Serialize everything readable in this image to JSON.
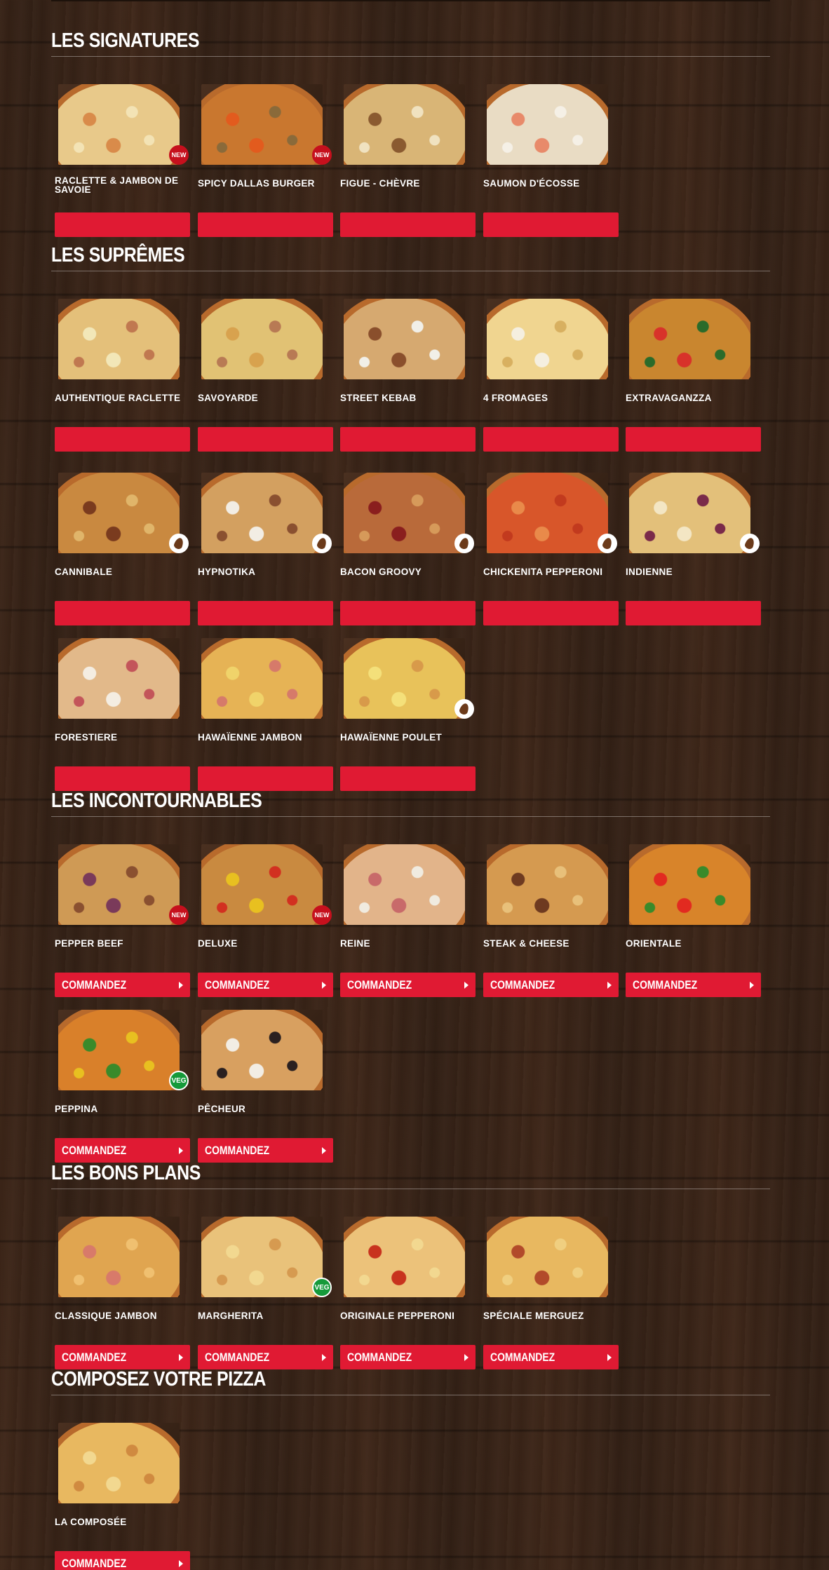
{
  "sections": [
    {
      "title": "LES SIGNATURES",
      "items": [
        {
          "name": "RACLETTE & JAMBON DE SAVOIE",
          "badge": "NEW",
          "colors": [
            "#e8c98a",
            "#d98b4a",
            "#f3e3b5"
          ]
        },
        {
          "name": "SPICY DALLAS BURGER",
          "badge": "NEW",
          "colors": [
            "#c9772f",
            "#e25b1e",
            "#8a6a3a"
          ]
        },
        {
          "name": "FIGUE - CHÈVRE",
          "badge": "",
          "colors": [
            "#d9b576",
            "#8a5a30",
            "#f0e2c0"
          ]
        },
        {
          "name": "SAUMON D'ÉCOSSE",
          "badge": "",
          "colors": [
            "#e9dcc4",
            "#e88a6a",
            "#f5f0e6"
          ]
        }
      ],
      "button_label": ""
    },
    {
      "title": "LES SUPRÊMES",
      "items": [
        {
          "name": "AUTHENTIQUE RACLETTE",
          "badge": "",
          "colors": [
            "#e4c07a",
            "#f2e7b8",
            "#c07850"
          ]
        },
        {
          "name": "SAVOYARDE",
          "badge": "",
          "colors": [
            "#e1c274",
            "#d8a24e",
            "#b87a54"
          ]
        },
        {
          "name": "STREET KEBAB",
          "badge": "",
          "colors": [
            "#d6a970",
            "#8a4f2c",
            "#f1efe8"
          ]
        },
        {
          "name": "4 FROMAGES",
          "badge": "",
          "colors": [
            "#f0d590",
            "#f5efe0",
            "#d8b060"
          ]
        },
        {
          "name": "EXTRAVAGANZZA",
          "badge": "",
          "colors": [
            "#c9862f",
            "#d8322a",
            "#2b6b2a"
          ]
        },
        {
          "name": "CANNIBALE",
          "badge": "spicy",
          "colors": [
            "#c98940",
            "#7a3b1e",
            "#e0b56a"
          ]
        },
        {
          "name": "HYPNOTIKA",
          "badge": "spicy",
          "colors": [
            "#d3a060",
            "#f2ede4",
            "#8a5030"
          ]
        },
        {
          "name": "BACON GROOVY",
          "badge": "spicy",
          "colors": [
            "#b96a3a",
            "#8a1e1e",
            "#d69a5a"
          ]
        },
        {
          "name": "CHICKENITA PEPPERONI",
          "badge": "spicy",
          "colors": [
            "#d8562a",
            "#e98a4a",
            "#c23a1e"
          ]
        },
        {
          "name": "INDIENNE",
          "badge": "spicy",
          "colors": [
            "#e3c07a",
            "#f3e6c4",
            "#7a2a4a"
          ]
        },
        {
          "name": "FORESTIERE",
          "badge": "",
          "colors": [
            "#e2b98a",
            "#f4ede2",
            "#c3555a"
          ]
        },
        {
          "name": "HAWAÏENNE JAMBON",
          "badge": "",
          "colors": [
            "#e6b355",
            "#f0d36a",
            "#d67a6a"
          ]
        },
        {
          "name": "HAWAÏENNE POULET",
          "badge": "spicy",
          "colors": [
            "#e8c25a",
            "#f4e07a",
            "#d89a4a"
          ]
        }
      ],
      "button_label": ""
    },
    {
      "title": "LES INCONTOURNABLES",
      "items": [
        {
          "name": "PEPPER BEEF",
          "badge": "NEW",
          "colors": [
            "#cf9a55",
            "#7a3a5a",
            "#8a5030"
          ]
        },
        {
          "name": "DELUXE",
          "badge": "NEW",
          "colors": [
            "#c98a40",
            "#e8c020",
            "#d23020"
          ]
        },
        {
          "name": "REINE",
          "badge": "",
          "colors": [
            "#e2b48a",
            "#c86a6a",
            "#f0ebe0"
          ]
        },
        {
          "name": "STEAK & CHEESE",
          "badge": "",
          "colors": [
            "#d59a50",
            "#6e3a20",
            "#e8c07a"
          ]
        },
        {
          "name": "ORIENTALE",
          "badge": "",
          "colors": [
            "#d8842a",
            "#e22a20",
            "#3a8a2a"
          ]
        },
        {
          "name": "PEPPINA",
          "badge": "VEG",
          "colors": [
            "#d9802a",
            "#3a8a2a",
            "#e8c020"
          ]
        },
        {
          "name": "PÊCHEUR",
          "badge": "",
          "colors": [
            "#d8a060",
            "#f2ede4",
            "#2a2020"
          ]
        }
      ],
      "button_label": "COMMANDEZ"
    },
    {
      "title": "LES BONS PLANS",
      "items": [
        {
          "name": "CLASSIQUE JAMBON",
          "badge": "",
          "colors": [
            "#e0a550",
            "#d87a6a",
            "#f0c070"
          ]
        },
        {
          "name": "MARGHERITA",
          "badge": "VEG",
          "colors": [
            "#e9c27a",
            "#f2d890",
            "#d69a50"
          ]
        },
        {
          "name": "ORIGINALE PEPPERONI",
          "badge": "",
          "colors": [
            "#ecc27a",
            "#c8321e",
            "#f2d890"
          ]
        },
        {
          "name": "SPÉCIALE MERGUEZ",
          "badge": "",
          "colors": [
            "#e8b860",
            "#b24a2a",
            "#f0cf80"
          ]
        }
      ],
      "button_label": "COMMANDEZ"
    },
    {
      "title": "COMPOSEZ VOTRE PIZZA",
      "items": [
        {
          "name": "LA COMPOSÉE",
          "badge": "",
          "colors": [
            "#e8b860",
            "#f2d890",
            "#d08a40"
          ]
        }
      ],
      "button_label": "COMMANDEZ"
    }
  ],
  "colors": {
    "accent": "#e01a33",
    "badge_new": "#c6101d",
    "badge_veg": "#159a3a",
    "background": "#3a2519"
  }
}
